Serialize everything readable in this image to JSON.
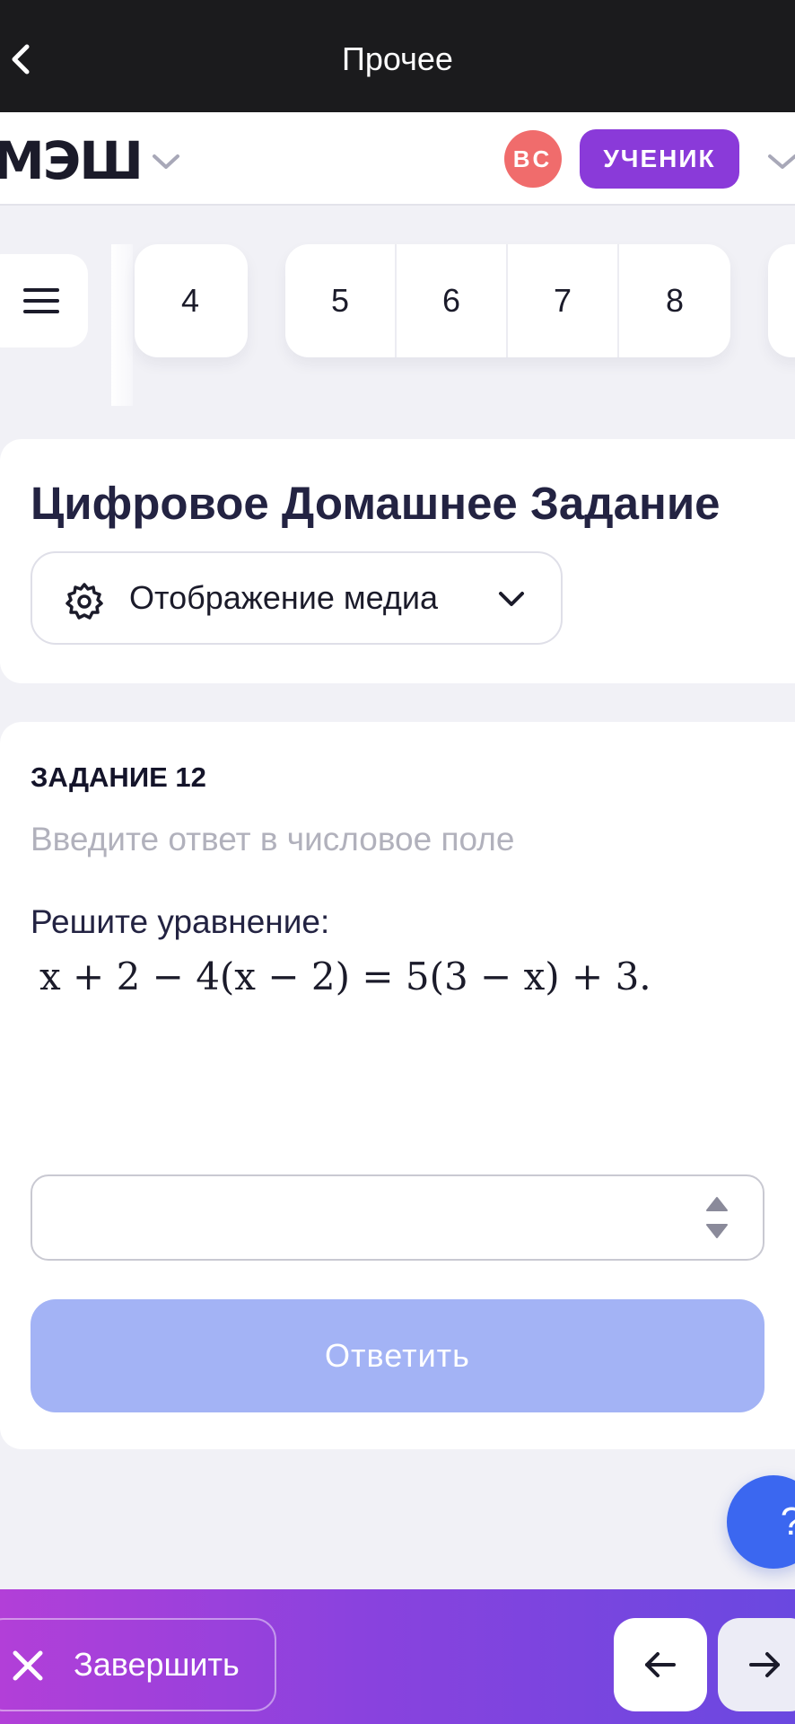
{
  "topbar": {
    "title": "Прочее"
  },
  "header": {
    "logo": "МЭШ",
    "avatar_initials": "ВС",
    "role": "УЧЕНИК",
    "colors": {
      "avatar": "#f06c6c",
      "role": "#8a3ad9"
    }
  },
  "nav": {
    "group1": [
      "4"
    ],
    "group2": [
      "5",
      "6",
      "7",
      "8"
    ]
  },
  "page": {
    "title": "Цифровое Домашнее Задание",
    "media_label": "Отображение медиа"
  },
  "task": {
    "label": "ЗАДАНИЕ 12",
    "hint": "Введите ответ в числовое поле",
    "question": "Решите уравнение:",
    "equation": "x + 2 − 4(x − 2) = 5(3 − x) + 3.",
    "answer_value": "",
    "submit_label": "Ответить"
  },
  "help": {
    "label": "?"
  },
  "bottom": {
    "finish_label": "Завершить",
    "prev_icon": "arrow-left-icon",
    "next_icon": "arrow-right-icon"
  }
}
